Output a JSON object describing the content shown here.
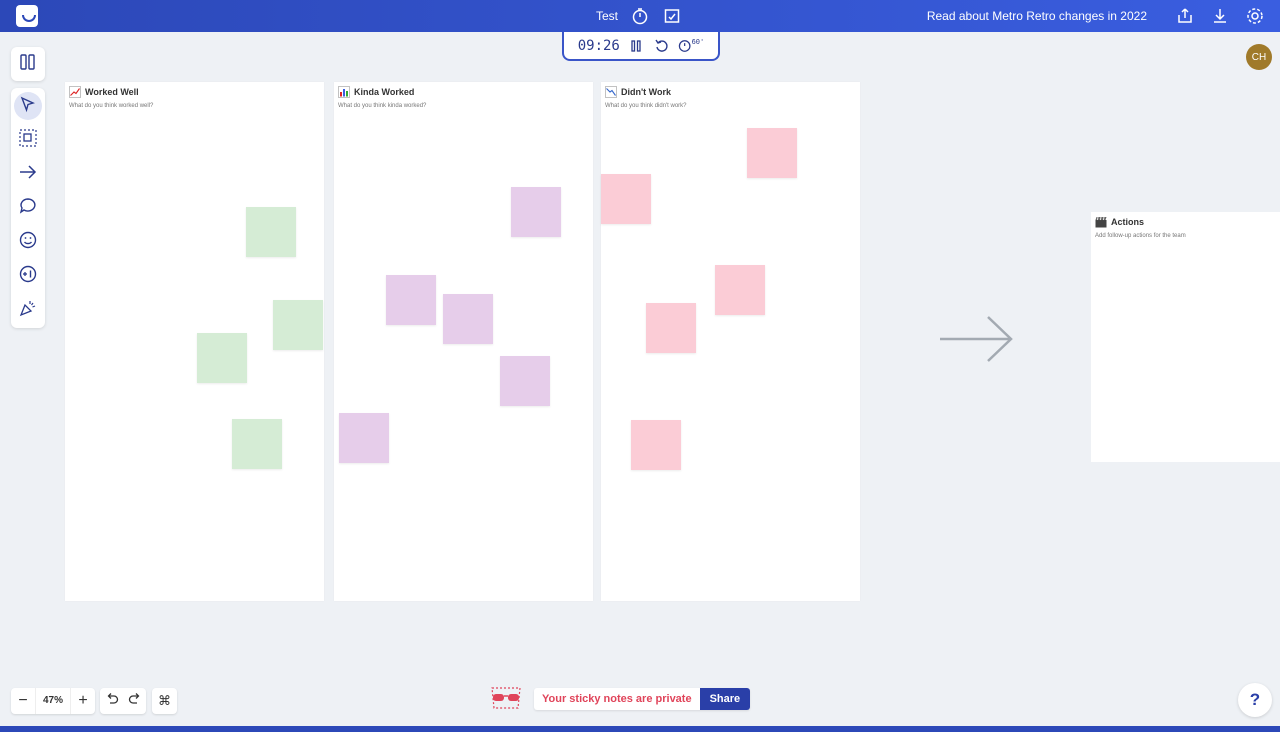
{
  "topbar": {
    "board_title": "Test",
    "news_link": "Read about Metro Retro changes in 2022"
  },
  "timer": {
    "time": "09:26",
    "extend_label": "60'"
  },
  "user": {
    "initials": "CH"
  },
  "columns": [
    {
      "title": "Worked Well",
      "subtitle": "What do you think worked well?"
    },
    {
      "title": "Kinda Worked",
      "subtitle": "What do you think kinda worked?"
    },
    {
      "title": "Didn't Work",
      "subtitle": "What do you think didn't work?"
    }
  ],
  "actions": {
    "title": "Actions",
    "subtitle": "Add follow-up actions for the team"
  },
  "notes": {
    "green": 4,
    "purple": 5,
    "pink": 5
  },
  "zoom": {
    "level": "47%"
  },
  "privacy": {
    "message": "Your sticky notes are private",
    "share_label": "Share"
  },
  "help": {
    "label": "?"
  },
  "colors": {
    "accent": "#2c48b8",
    "green_note": "#d5ecd5",
    "purple_note": "#e6cdea",
    "pink_note": "#fbccd6",
    "privacy_text": "#e0445a"
  },
  "icons": {
    "topbar": [
      "metro-retro-logo",
      "timer-icon",
      "board-check-icon",
      "share-export-icon",
      "download-icon",
      "settings-gear-icon"
    ],
    "tools": [
      "columns-panel-icon",
      "select-pointer-icon",
      "shapes-icon",
      "arrow-tool-icon",
      "comment-icon",
      "emoji-icon",
      "plus-one-icon",
      "celebration-icon"
    ]
  }
}
